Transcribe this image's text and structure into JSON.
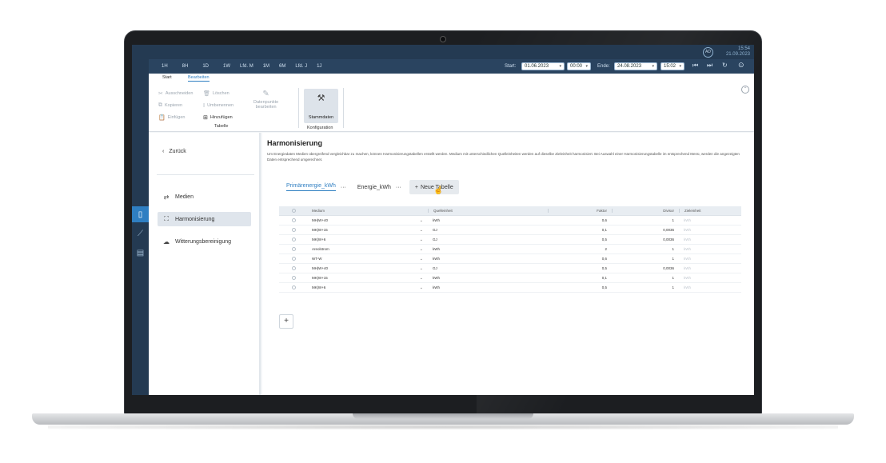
{
  "topbar": {
    "avatar": "AD",
    "time": "15:54",
    "date": "21.09.2023"
  },
  "toolbar": {
    "ranges": [
      "1H",
      "8H",
      "1D",
      "1W",
      "Lfd. M",
      "1M",
      "6M",
      "Lfd. J",
      "1J"
    ],
    "start_label": "Start:",
    "start_date": "01.06.2023",
    "start_time": "00:00",
    "end_label": "Ende:",
    "end_date": "24.08.2023",
    "end_time": "15:02"
  },
  "ribbon": {
    "tabs": [
      "Start",
      "Bearbeiten"
    ],
    "cut": "Ausschneiden",
    "delete": "Löschen",
    "copy": "Kopieren",
    "rename": "Umbenennen",
    "paste": "Einfügen",
    "add": "Hinzufügen",
    "datapoints_line1": "Datenpunkte",
    "datapoints_line2": "bearbeiten",
    "group_table": "Tabelle",
    "master_data": "Stammdaten",
    "group_config": "Konfiguration"
  },
  "side": {
    "back": "Zurück",
    "items": [
      "Medien",
      "Harmonisierung",
      "Witterungsbereinigung"
    ]
  },
  "main": {
    "title": "Harmonisierung",
    "description": "Um Energiedaten Medien übergreifend vergleichbar zu machen, können Harmonisierungstabellen erstellt werden. Medium mit unterschiedlichen Quelleinheiten werden auf dieselbe Zieleinheit harmonisiert. Bei Auswahl einer Harmonisierungstabelle im entsprechend Menü, werden die angezeigten Daten entsprechend umgerechnet.",
    "tabs": [
      "Primärenergie_kWh",
      "Energie_kWh"
    ],
    "tab_dots": "···",
    "new_table": "Neue Tabelle",
    "add": "+"
  },
  "table": {
    "headers": [
      "Medium",
      "Quelleinheit",
      "Faktor",
      "Divisor",
      "Zieleinheit"
    ],
    "rows": [
      [
        "MH|W+40",
        "kWh",
        "0,6",
        "1",
        "kWh"
      ],
      [
        "MK|W+15",
        "GJ",
        "0,1",
        "0,0036",
        "kWh"
      ],
      [
        "MK|W+6",
        "GJ",
        "0,5",
        "0,0036",
        "kWh"
      ],
      [
        "Areolstrom",
        "kWh",
        "2",
        "1",
        "kWh"
      ],
      [
        "WT-W",
        "kWh",
        "0,6",
        "1",
        "kWh"
      ],
      [
        "MH|W+40",
        "GJ",
        "0,5",
        "0,0036",
        "kWh"
      ],
      [
        "MK|W+15",
        "kWh",
        "0,1",
        "1",
        "kWh"
      ],
      [
        "MK|W+6",
        "kWh",
        "0,5",
        "1",
        "kWh"
      ]
    ]
  },
  "colors": {
    "accent": "#2f7fc2",
    "topbar": "#243a52"
  }
}
